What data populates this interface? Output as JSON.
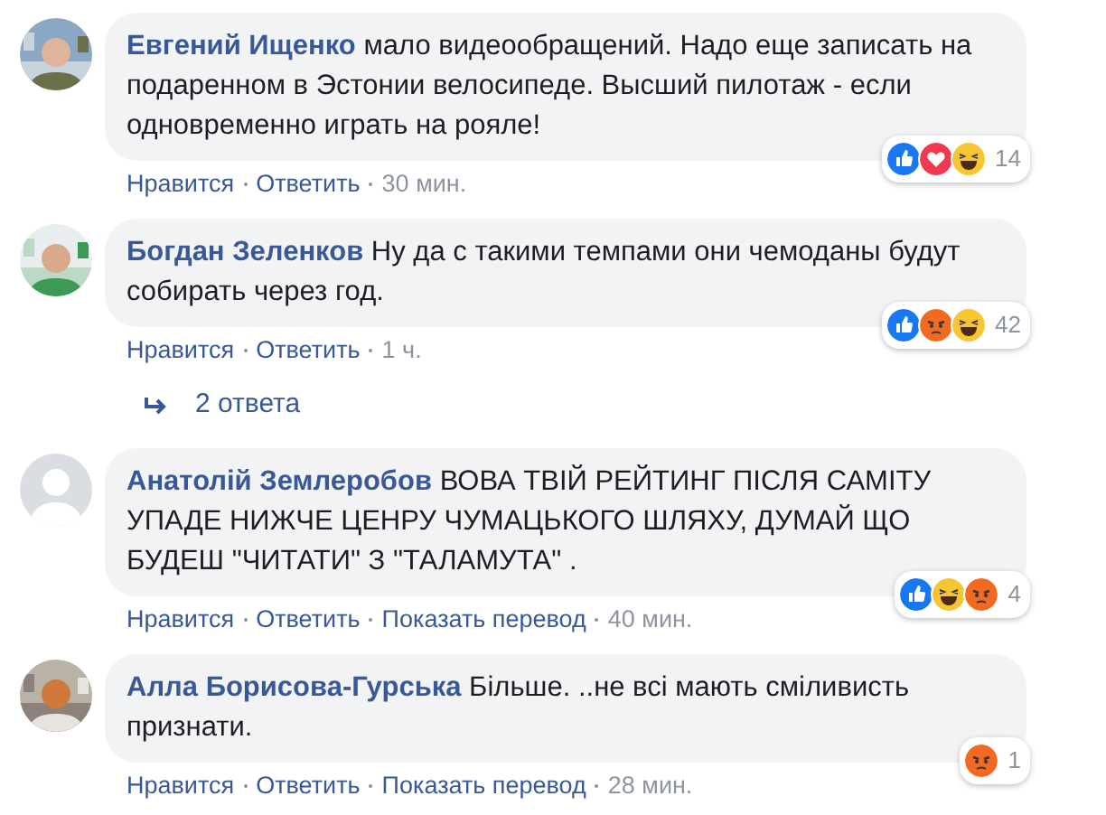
{
  "comments": [
    {
      "author": "Евгений Ищенко",
      "avatar": {
        "kind": "picture"
      },
      "text": "мало видеообращений. Надо еще записать на подаренном в Эстонии велосипеде. Высший пилотаж - если одновременно играть на рояле!",
      "actions": [
        "Нравится",
        "Ответить"
      ],
      "time": "30 мин.",
      "reactions": [
        {
          "kind": "like"
        },
        {
          "kind": "love"
        },
        {
          "kind": "haha"
        }
      ],
      "reaction_count": "14"
    },
    {
      "author": "Богдан Зеленков",
      "avatar": {
        "kind": "picture"
      },
      "text": "Ну да с такими темпами они чемоданы будут собирать через год.",
      "actions": [
        "Нравится",
        "Ответить"
      ],
      "time": "1 ч.",
      "reactions": [
        {
          "kind": "like"
        },
        {
          "kind": "angry"
        },
        {
          "kind": "haha"
        }
      ],
      "reaction_count": "42",
      "replies": "2 ответа"
    },
    {
      "author": "Анатолій Землеробов",
      "avatar": {
        "kind": "default"
      },
      "text": "ВОВА ТВІЙ РЕЙТИНГ ПІСЛЯ САМІТУ УПАДЕ НИЖЧЕ ЦЕНРУ ЧУМАЦЬКОГО ШЛЯХУ, ДУМАЙ ЩО БУДЕШ \"ЧИТАТИ\" З \"ТАЛАМУТА\" .",
      "actions": [
        "Нравится",
        "Ответить",
        "Показать перевод"
      ],
      "time": "40 мин.",
      "reactions": [
        {
          "kind": "like"
        },
        {
          "kind": "haha"
        },
        {
          "kind": "angry"
        }
      ],
      "reaction_count": "4"
    },
    {
      "author": "Алла Борисова-Гурська",
      "avatar": {
        "kind": "picture"
      },
      "text": "Більше. ..не всі мають сміливисть признати.",
      "actions": [
        "Нравится",
        "Ответить",
        "Показать перевод"
      ],
      "time": "28 мин.",
      "reactions": [
        {
          "kind": "angry"
        }
      ],
      "reaction_count": "1"
    }
  ]
}
